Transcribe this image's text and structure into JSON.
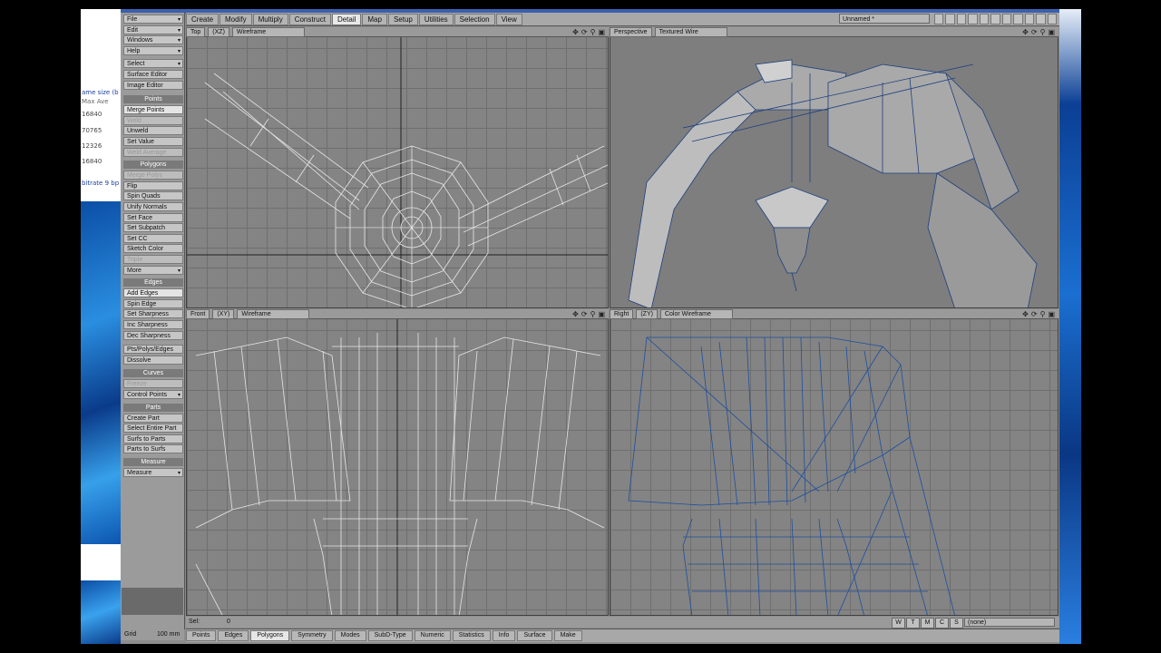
{
  "background_window": {
    "lines": [
      "ame size (b",
      "Max   Ave",
      "16840",
      "70765",
      "12326",
      "16840",
      "bitrate 9 bp"
    ],
    "side_value": "0"
  },
  "top_tabs": [
    "Create",
    "Modify",
    "Multiply",
    "Construct",
    "Detail",
    "Map",
    "Setup",
    "Utilities",
    "Selection",
    "View"
  ],
  "active_tab": "Detail",
  "object_selector": "Unnamed *",
  "sidebar": {
    "top_menus": [
      "File",
      "Edit",
      "Windows",
      "Help"
    ],
    "tools": [
      "Select",
      "Surface Editor",
      "Image Editor"
    ],
    "points_header": "Points",
    "points": [
      "Merge Points",
      "Weld",
      "Unweld",
      "Set Value",
      "Weld Average"
    ],
    "polygons_header": "Polygons",
    "polygons": [
      "Merge Polys",
      "Flip",
      "Spin Quads",
      "Unify Normals",
      "Set Face",
      "Set Subpatch",
      "Set CC",
      "Sketch Color",
      "Triple",
      "More"
    ],
    "edges_header": "Edges",
    "edges": [
      "Add Edges",
      "Spin Edge",
      "Set Sharpness",
      "Inc Sharpness",
      "Dec Sharpness"
    ],
    "misc": [
      "Pts/Polys/Edges",
      "Dissolve"
    ],
    "curves_header": "Curves",
    "curves": [
      "Freeze",
      "Control Points"
    ],
    "parts_header": "Parts",
    "parts": [
      "Create Part",
      "Select Entire Part",
      "Surfs to Parts",
      "Parts to Surfs"
    ],
    "measure_header": "Measure",
    "measure": [
      "Measure"
    ]
  },
  "viewports": {
    "top": {
      "view": "Top",
      "axis": "(XZ)",
      "mode": "Wireframe"
    },
    "perspective": {
      "view": "Perspective",
      "mode": "Textured Wire"
    },
    "front": {
      "view": "Front",
      "axis": "(XY)",
      "mode": "Wireframe"
    },
    "right": {
      "view": "Right",
      "axis": "(ZY)",
      "mode": "Color Wireframe"
    }
  },
  "status": {
    "sel_label": "Sel:",
    "sel_value": "0",
    "grid_label": "Grid",
    "grid_value": "100 mm"
  },
  "wtmcs": [
    "W",
    "T",
    "M",
    "C",
    "S"
  ],
  "layer_selector": "(none)",
  "bottom_buttons": [
    "Points",
    "Edges",
    "Polygons",
    "Symmetry",
    "Modes",
    "SubD-Type",
    "Numeric",
    "Statistics",
    "Info",
    "Surface",
    "Make"
  ],
  "active_bottom": "Polygons",
  "colors": {
    "wire_white": "#e8e8e8",
    "wire_blue": "#1d4f9e",
    "grid": "#6f6f6f",
    "viewport_bg": "#848484"
  }
}
